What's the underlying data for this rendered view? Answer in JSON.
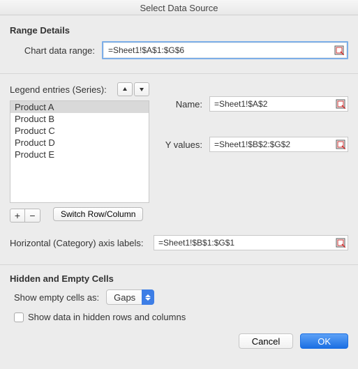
{
  "window": {
    "title": "Select Data Source"
  },
  "range": {
    "section_title": "Range Details",
    "chart_range_label": "Chart data range:",
    "chart_range_value": "=Sheet1!$A$1:$G$6"
  },
  "legend": {
    "header": "Legend entries (Series):",
    "items": [
      "Product A",
      "Product B",
      "Product C",
      "Product D",
      "Product E"
    ],
    "selected_index": 0,
    "add_label": "+",
    "remove_label": "−",
    "switch_label": "Switch Row/Column"
  },
  "series": {
    "name_label": "Name:",
    "name_value": "=Sheet1!$A$2",
    "y_label": "Y values:",
    "y_value": "=Sheet1!$B$2:$G$2"
  },
  "category": {
    "label": "Horizontal (Category) axis labels:",
    "value": "=Sheet1!$B$1:$G$1"
  },
  "hidden": {
    "section_title": "Hidden and Empty Cells",
    "show_empty_label": "Show empty cells as:",
    "show_empty_value": "Gaps",
    "checkbox_label": "Show data in hidden rows and columns",
    "checkbox_checked": false
  },
  "footer": {
    "cancel": "Cancel",
    "ok": "OK"
  }
}
